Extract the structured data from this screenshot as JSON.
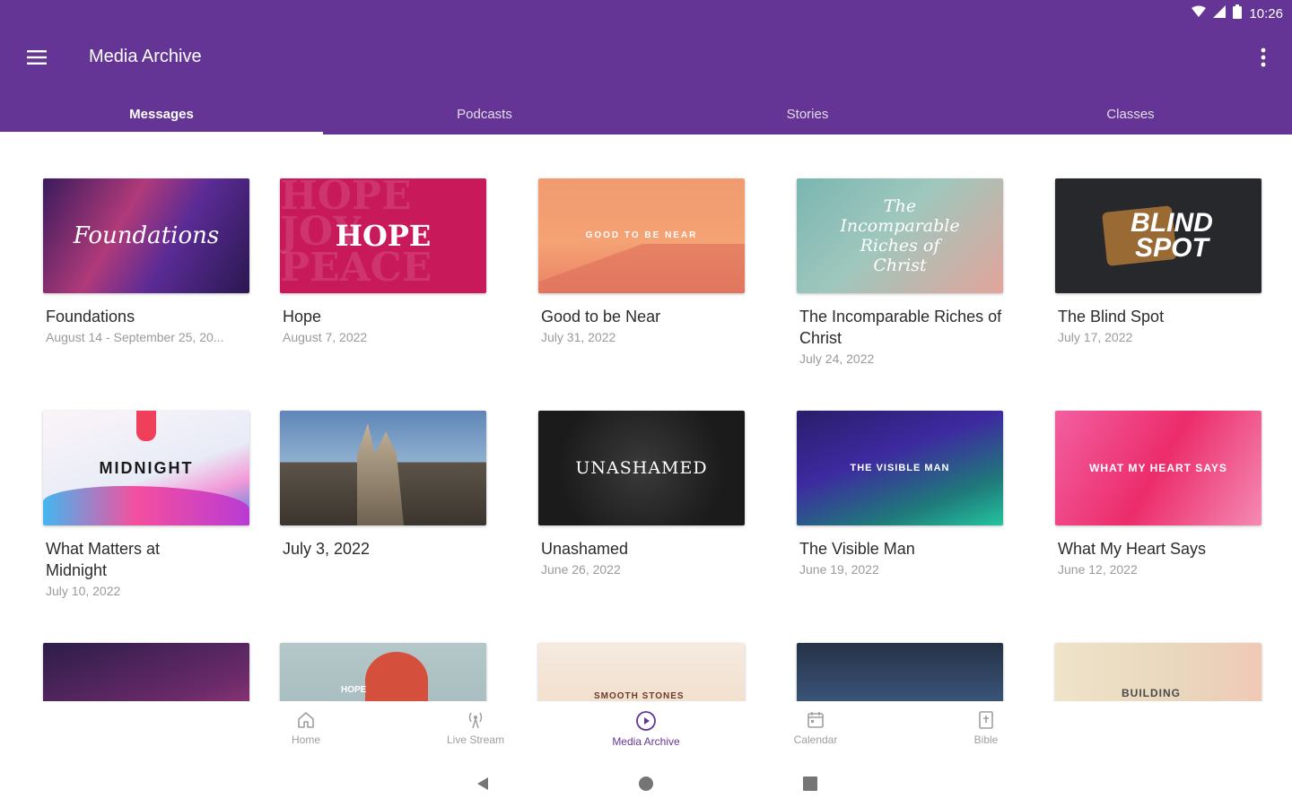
{
  "status": {
    "time": "10:26"
  },
  "appbar": {
    "title": "Media Archive",
    "bg_color": "#653595"
  },
  "tabs": [
    {
      "label": "Messages",
      "active": true
    },
    {
      "label": "Podcasts",
      "active": false
    },
    {
      "label": "Stories",
      "active": false
    },
    {
      "label": "Classes",
      "active": false
    }
  ],
  "cards": [
    {
      "title": "Foundations",
      "subtitle": "August 14 - September 25, 20...",
      "thumb_text": "Foundations"
    },
    {
      "title": "Hope",
      "subtitle": "August 7, 2022",
      "thumb_text": "HOPE",
      "thumb_bg_text": "HOPE JOY PEACE"
    },
    {
      "title": "Good to be Near",
      "subtitle": "July 31, 2022",
      "thumb_text": "GOOD TO BE NEAR"
    },
    {
      "title": "The Incomparable Riches of Christ",
      "subtitle": "July 24, 2022",
      "thumb_text": "The Incomparable Riches of Christ"
    },
    {
      "title": "The Blind Spot",
      "subtitle": "July 17, 2022",
      "thumb_text": "BLIND SPOT"
    },
    {
      "title": "What Matters at Midnight",
      "subtitle": "July 10, 2022",
      "thumb_text": "MIDNIGHT"
    },
    {
      "title": "July 3, 2022",
      "subtitle": "",
      "thumb_text": ""
    },
    {
      "title": "Unashamed",
      "subtitle": "June 26, 2022",
      "thumb_text": "UNASHAMED"
    },
    {
      "title": "The Visible Man",
      "subtitle": "June 19, 2022",
      "thumb_text": "THE VISIBLE MAN"
    },
    {
      "title": "What My Heart Says",
      "subtitle": "June 12, 2022",
      "thumb_text": "WHAT MY HEART SAYS"
    }
  ],
  "partial_row": [
    {
      "thumb_text": ""
    },
    {
      "thumb_text": "HOPE"
    },
    {
      "thumb_text": "SMOOTH STONES"
    },
    {
      "thumb_text": ""
    },
    {
      "thumb_text": "BUILDING"
    }
  ],
  "bottom_nav": [
    {
      "label": "Home",
      "icon": "home-icon",
      "active": false
    },
    {
      "label": "Live Stream",
      "icon": "broadcast-icon",
      "active": false
    },
    {
      "label": "Media Archive",
      "icon": "play-circle-icon",
      "active": true
    },
    {
      "label": "Calendar",
      "icon": "calendar-icon",
      "active": false
    },
    {
      "label": "Bible",
      "icon": "bible-icon",
      "active": false
    }
  ],
  "colors": {
    "accent": "#653595",
    "text": "#2b2b2b",
    "muted": "#9a9a9a"
  }
}
